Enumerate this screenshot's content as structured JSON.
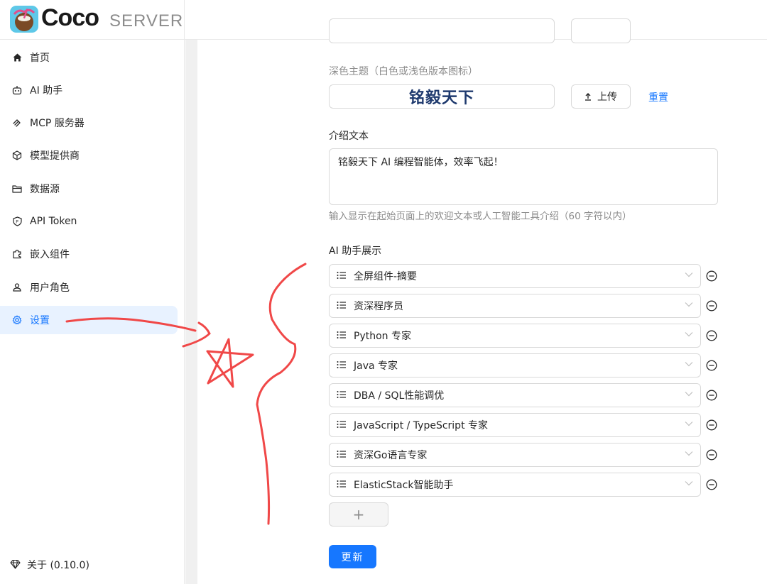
{
  "header": {
    "brand": "Coco",
    "brand_sub": "SERVER"
  },
  "sidebar": {
    "items": [
      {
        "label": "首页",
        "icon": "home-icon"
      },
      {
        "label": "AI 助手",
        "icon": "robot-icon"
      },
      {
        "label": "MCP 服务器",
        "icon": "mcp-icon"
      },
      {
        "label": "模型提供商",
        "icon": "cube-icon"
      },
      {
        "label": "数据源",
        "icon": "folder-icon"
      },
      {
        "label": "API Token",
        "icon": "shield-icon"
      },
      {
        "label": "嵌入组件",
        "icon": "puzzle-icon"
      },
      {
        "label": "用户角色",
        "icon": "user-icon"
      },
      {
        "label": "设置",
        "icon": "gear-icon",
        "active": true
      }
    ],
    "about": "关于 (0.10.0)"
  },
  "settings": {
    "dark_theme_label": "深色主题（白色或浅色版本图标）",
    "logo_text": "铭毅天下",
    "upload_label": "上传",
    "reset_label": "重置",
    "intro_label": "介绍文本",
    "intro_value": "铭毅天下 AI 编程智能体，效率飞起！",
    "intro_help": "输入显示在起始页面上的欢迎文本或人工智能工具介绍（60 字符以内）",
    "assistants_label": "AI 助手展示",
    "assistants": [
      "全屏组件-摘要",
      "资深程序员",
      "Python 专家",
      "Java 专家",
      "DBA / SQL性能调优",
      "JavaScript / TypeScript 专家",
      "资深Go语言专家",
      "ElasticStack智能助手"
    ],
    "add_label": "+",
    "submit_label": "更新"
  },
  "colors": {
    "primary": "#1677ff",
    "active_bg": "#e8f2ff",
    "annotation": "#f04848"
  }
}
